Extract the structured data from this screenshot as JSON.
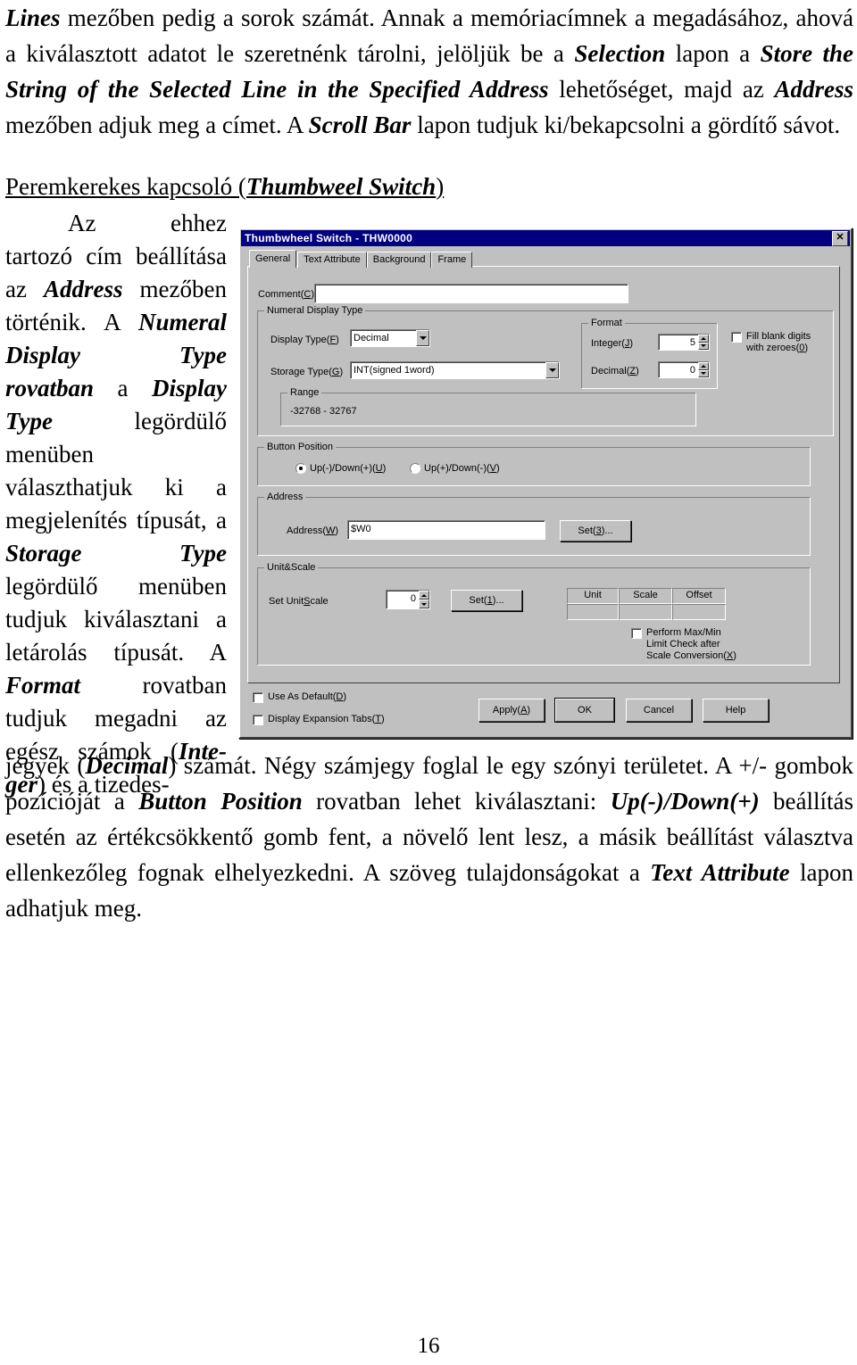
{
  "document": {
    "page_number": "16",
    "top_paragraph_html": "<span class=\"bi\">Lines</span> mezőben pedig a sorok számát. Annak a memóriacímnek a megadásához, ahová a kiválasztott adatot le szeretnénk tárolni, jelöljük be a <span class=\"bi\">Selection</span> lapon a <span class=\"bi\">Store the String of the Selected Line in the Specified Address</span> lehetőséget, majd az <span class=\"bi\">Address</span> mezőben adjuk meg a címet. A <span class=\"bi\">Scroll Bar</span> lapon tudjuk ki/bekapcsolni a gördítő sávot.",
    "section_heading_html": "Peremkerekes kapcsoló (<span class=\"bi\">Thumbweel Switch</span>)",
    "left_column_html": "<p>Az ehhez tartozó cím beállítása az <span class=\"bi\">Address</span> mezőben történik. A <span class=\"bi\">Numeral Display Type rovatban</span> a <span class=\"bi\">Display Type</span> legördülő menüben választhatjuk ki a megjelenítés típusát, a <span class=\"bi\">Storage Type</span> legördülő menüben tudjuk kiválasztani a letárolás típusát. A <span class=\"bi\">Format</span> rovatban tudjuk megadni az egész számok (<span class=\"bi\">Inte-ger</span>) és a tizedes-</p>",
    "bottom_paragraph_html": "jegyek (<span class=\"bi\">Decimal</span>) számát. Négy számjegy foglal le egy szónyi területet. A +/- gombok pozícióját a <span class=\"bi\">Button Position</span> rovatban lehet kiválasztani: <span class=\"bi\">Up(-)/Down(+)</span> beállítás esetén az értékcsökkentő gomb fent, a növelő lent lesz, a másik beállítást választva ellenkezőleg fognak elhelyezkedni. A szöveg tulajdonságokat a <span class=\"bi\">Text Attribute</span> lapon adhatjuk meg."
  },
  "dialog": {
    "title": "Thumbwheel Switch - THW0000",
    "close_label": "✕",
    "colors": {
      "titlebar": "#000080",
      "face": "#c0c0c0",
      "field": "#ffffff",
      "shadow": "#404040"
    },
    "tabs": [
      {
        "label": "General",
        "active": true
      },
      {
        "label": "Text Attribute",
        "active": false
      },
      {
        "label": "Background",
        "active": false
      },
      {
        "label": "Frame",
        "active": false
      }
    ],
    "comment": {
      "label": "Comment(C)",
      "label_plain": "Comment",
      "accel": "C",
      "value": ""
    },
    "numeral_display_type": {
      "title": "Numeral Display Type",
      "display_type": {
        "label_pre": "Display Type(",
        "accel": "F",
        "label_post": ")",
        "value": "Decimal"
      },
      "storage_type": {
        "label_pre": "Storage Type(",
        "accel": "G",
        "label_post": ")",
        "value": "INT(signed 1word)"
      },
      "range": {
        "title": "Range",
        "value": "-32768 - 32767"
      },
      "format": {
        "title": "Format",
        "integer": {
          "label_pre": "Integer(",
          "accel": "J",
          "label_post": ")",
          "value": "5"
        },
        "decimal": {
          "label_pre": "Decimal(",
          "accel": "Z",
          "label_post": ")",
          "value": "0"
        }
      },
      "fill_blank": {
        "line1": "Fill blank digits",
        "line2_pre": "with zeroes(",
        "accel": "0",
        "line2_post": ")",
        "checked": false
      }
    },
    "button_position": {
      "title": "Button Position",
      "options": [
        {
          "label_pre": "Up(-)/Down(+)(",
          "accel": "U",
          "label_post": ")",
          "selected": true
        },
        {
          "label_pre": "Up(+)/Down(-)(",
          "accel": "V",
          "label_post": ")",
          "selected": false
        }
      ]
    },
    "address": {
      "title": "Address",
      "label_pre": "Address(",
      "accel": "W",
      "label_post": ")",
      "value": "$W0",
      "set_button": {
        "pre": "Set(",
        "accel": "3",
        "post": ")..."
      }
    },
    "unit_scale": {
      "title": "Unit&Scale",
      "set_label_pre": "Set Unit",
      "set_label_accel": "S",
      "set_label_post": "cale",
      "value": "0",
      "set_button": {
        "pre": "Set(",
        "accel": "1",
        "post": ")..."
      },
      "table_headers": [
        "Unit",
        "Scale",
        "Offset"
      ],
      "table_values": [
        "",
        "",
        ""
      ],
      "max_min_check": {
        "line1": "Perform Max/Min",
        "line2": "Limit Check after",
        "line3_pre": "Scale Conversion(",
        "accel": "X",
        "line3_post": ")",
        "checked": false
      }
    },
    "footer": {
      "use_as_default": {
        "pre": "Use As Default(",
        "accel": "D",
        "post": ")",
        "checked": false
      },
      "display_expansion_tabs": {
        "pre": "Display Expansion Tabs(",
        "accel": "T",
        "post": ")",
        "checked": false
      },
      "buttons": [
        {
          "pre": "Apply(",
          "accel": "A",
          "post": ")",
          "default": false
        },
        {
          "pre": "OK",
          "accel": "",
          "post": "",
          "default": true
        },
        {
          "pre": "Cancel",
          "accel": "",
          "post": "",
          "default": false
        },
        {
          "pre": "Help",
          "accel": "",
          "post": "",
          "default": false
        }
      ]
    }
  }
}
